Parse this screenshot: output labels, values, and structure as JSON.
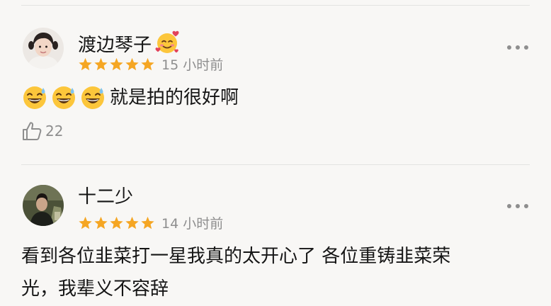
{
  "reviews": [
    {
      "username": "渡边琴子",
      "rating": 5,
      "time": "15 小时前",
      "content": "就是拍的很好啊",
      "content_emoji": "sweat-smile-icon",
      "likes": "22"
    },
    {
      "username": "十二少",
      "rating": 5,
      "time": "14 小时前",
      "content_line1": "看到各位韭菜打一星我真的太开心了 各位重铸韭菜荣",
      "content_line2": "光，我辈义不容辞"
    }
  ],
  "colors": {
    "star": "#f5a623",
    "muted": "#8e8e8e",
    "text": "#151515",
    "background": "#f8f7f5"
  }
}
